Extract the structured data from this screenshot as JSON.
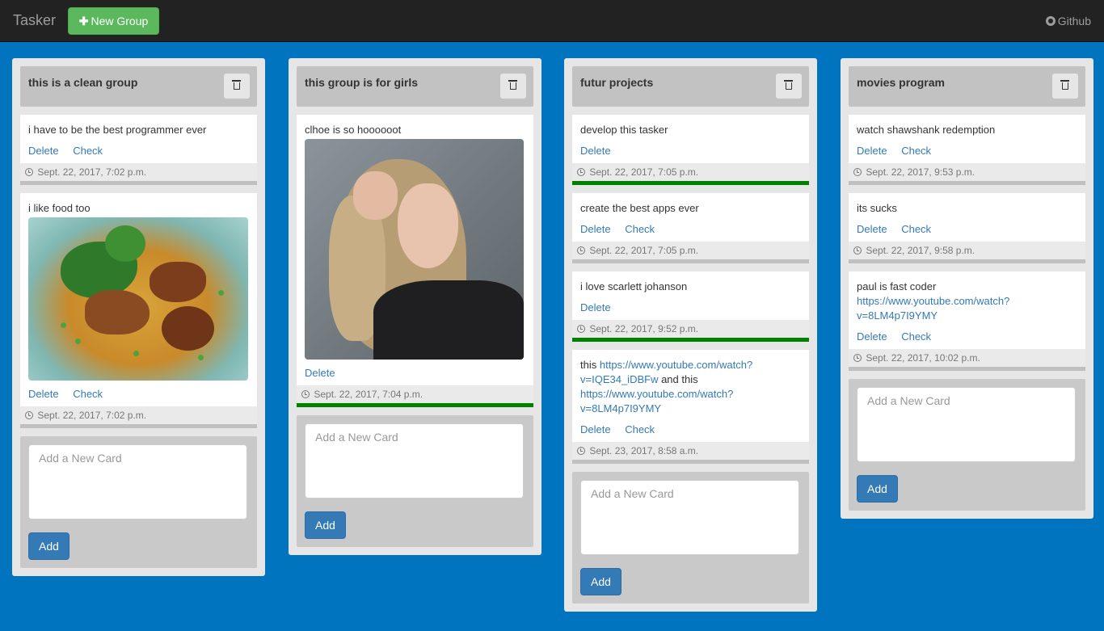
{
  "navbar": {
    "brand": "Tasker",
    "new_group_label": "New Group",
    "new_group_icon": "plus-icon",
    "github_label": "Github",
    "github_icon": "github-icon"
  },
  "colors": {
    "background": "#0074bf",
    "navbar": "#222222",
    "new_group_button": "#5cb85c",
    "add_button": "#337ab7",
    "done_bar": "#008000"
  },
  "groups": [
    {
      "title": "this is a clean group",
      "cards": [
        {
          "text": "i have to be the best programmer ever",
          "delete": "Delete",
          "check": "Check",
          "date": "Sept. 22, 2017, 7:02 p.m."
        },
        {
          "text": "i like food too",
          "delete": "Delete",
          "check": "Check",
          "date": "Sept. 22, 2017, 7:02 p.m."
        }
      ],
      "add_placeholder": "Add a New Card",
      "add_label": "Add"
    },
    {
      "title": "this group is for girls",
      "cards": [
        {
          "text": "clhoe is so hoooooot",
          "delete": "Delete",
          "date": "Sept. 22, 2017, 7:04 p.m."
        }
      ],
      "add_placeholder": "Add a New Card",
      "add_label": "Add"
    },
    {
      "title": "futur projects",
      "cards": [
        {
          "text": "develop this tasker",
          "delete": "Delete",
          "date": "Sept. 22, 2017, 7:05 p.m."
        },
        {
          "text": "create the best apps ever",
          "delete": "Delete",
          "check": "Check",
          "date": "Sept. 22, 2017, 7:05 p.m."
        },
        {
          "text": "i love scarlett johanson",
          "delete": "Delete",
          "date": "Sept. 22, 2017, 9:52 p.m."
        },
        {
          "text_prefix": "this",
          "link1": "https://www.youtube.com/watch?v=IQE34_iDBFw",
          "text_middle": "and this",
          "link2": "https://www.youtube.com/watch?v=8LM4p7I9YMY",
          "delete": "Delete",
          "check": "Check",
          "date": "Sept. 23, 2017, 8:58 a.m."
        }
      ],
      "add_placeholder": "Add a New Card",
      "add_label": "Add"
    },
    {
      "title": "movies program",
      "cards": [
        {
          "text": "watch shawshank redemption",
          "delete": "Delete",
          "check": "Check",
          "date": "Sept. 22, 2017, 9:53 p.m."
        },
        {
          "text": "its sucks",
          "delete": "Delete",
          "check": "Check",
          "date": "Sept. 22, 2017, 9:58 p.m."
        },
        {
          "text": "paul is fast coder",
          "link": "https://www.youtube.com/watch?v=8LM4p7I9YMY",
          "delete": "Delete",
          "check": "Check",
          "date": "Sept. 22, 2017, 10:02 p.m."
        }
      ],
      "add_placeholder": "Add a New Card",
      "add_label": "Add"
    }
  ]
}
